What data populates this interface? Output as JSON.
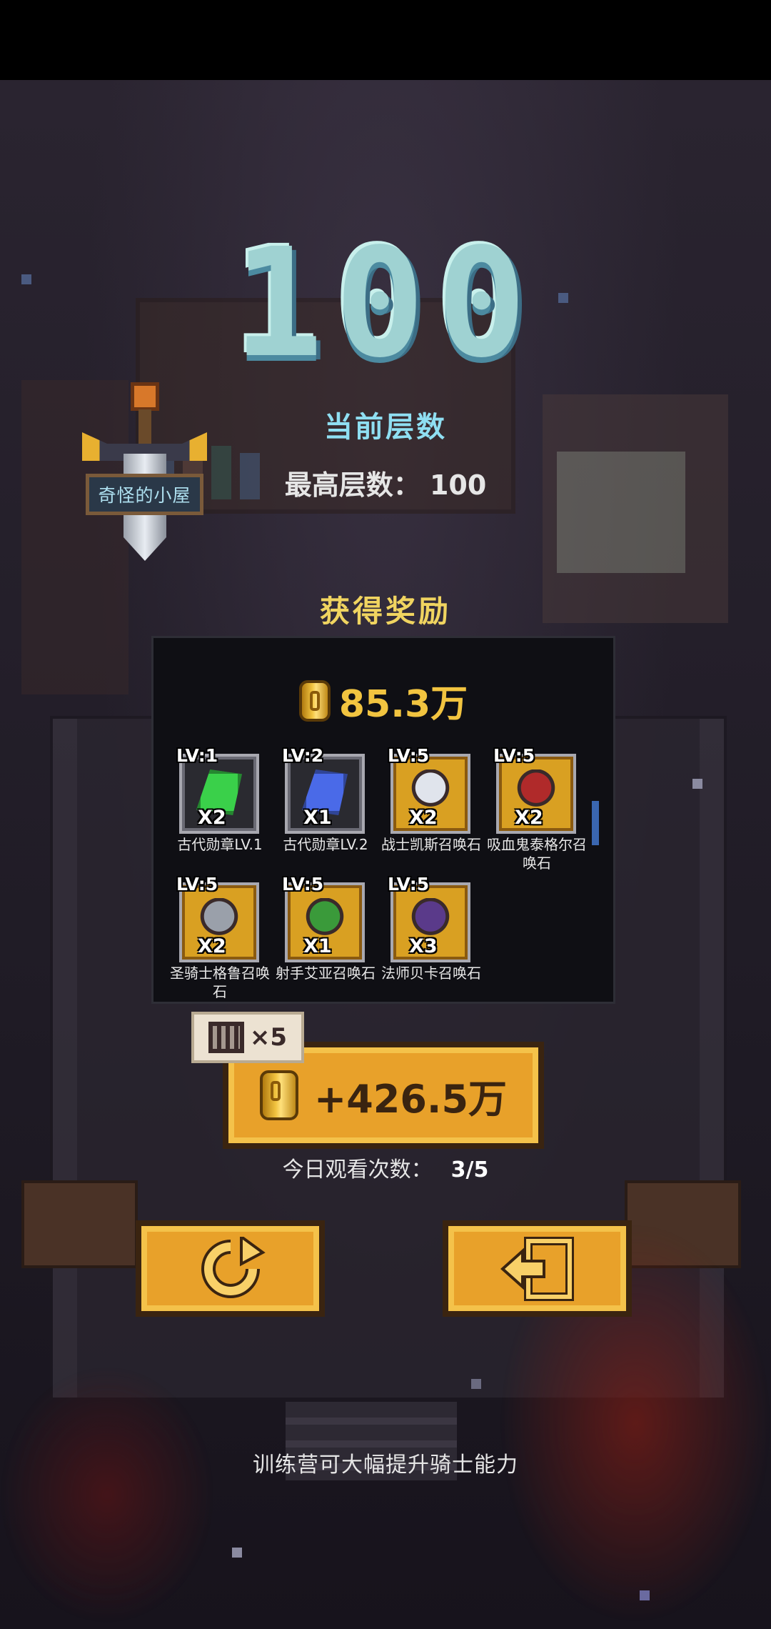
{
  "emblem": {
    "label": "奇怪的小屋"
  },
  "floor": {
    "number": "100",
    "current_label": "当前层数",
    "highest_label": "最高层数：",
    "highest_value": "100"
  },
  "rewards": {
    "title": "获得奖励",
    "gold": "85.3万",
    "items": [
      {
        "level": "LV:1",
        "count": "X2",
        "name": "古代勋章LV.1",
        "frame": "silver",
        "icon": "green-medal-icon",
        "color": "#3ad04a"
      },
      {
        "level": "LV:2",
        "count": "X1",
        "name": "古代勋章LV.2",
        "frame": "silver",
        "icon": "blue-medal-icon",
        "color": "#4a6ae8"
      },
      {
        "level": "LV:5",
        "count": "X2",
        "name": "战士凯斯召唤石",
        "frame": "gold",
        "icon": "warrior-portrait-icon",
        "color": "#e0e4ec"
      },
      {
        "level": "LV:5",
        "count": "X2",
        "name": "吸血鬼泰格尔召唤石",
        "frame": "gold",
        "icon": "vampire-portrait-icon",
        "color": "#b02a2a"
      },
      {
        "level": "LV:5",
        "count": "X2",
        "name": "圣骑士格鲁召唤石",
        "frame": "gold",
        "icon": "paladin-portrait-icon",
        "color": "#9aa0aa"
      },
      {
        "level": "LV:5",
        "count": "X1",
        "name": "射手艾亚召唤石",
        "frame": "gold",
        "icon": "archer-portrait-icon",
        "color": "#3a9a3a"
      },
      {
        "level": "LV:5",
        "count": "X3",
        "name": "法师贝卡召唤石",
        "frame": "gold",
        "icon": "mage-portrait-icon",
        "color": "#5a3a8a"
      }
    ]
  },
  "ad": {
    "multiplier": "×5",
    "amount": "+426.5万",
    "watch_label": "今日观看次数：",
    "watch_count": "3/5"
  },
  "tip": "训练营可大幅提升骑士能力"
}
